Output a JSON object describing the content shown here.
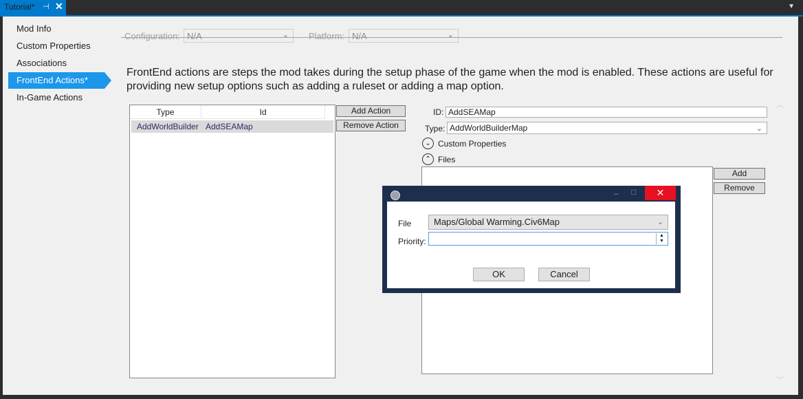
{
  "tab": {
    "title": "Tutorial*",
    "pin_glyph": "⊣",
    "close_glyph": "✕",
    "overflow_glyph": "▼"
  },
  "nav": {
    "items": [
      {
        "label": "Mod Info"
      },
      {
        "label": "Custom Properties"
      },
      {
        "label": "Associations"
      },
      {
        "label": "FrontEnd Actions*"
      },
      {
        "label": "In-Game Actions"
      }
    ],
    "selected_index": 3
  },
  "config": {
    "configuration_label": "Configuration:",
    "configuration_value": "N/A",
    "platform_label": "Platform:",
    "platform_value": "N/A"
  },
  "description": "FrontEnd actions are steps the mod takes during the setup phase of the game when the mod is enabled.  These actions are useful for providing new setup options such as adding a ruleset or adding a map option.",
  "actions_table": {
    "columns": [
      "Type",
      "Id"
    ],
    "rows": [
      [
        "AddWorldBuilderM",
        "AddSEAMap"
      ]
    ]
  },
  "buttons": {
    "add_action": "Add Action",
    "remove_action": "Remove Action",
    "add": "Add",
    "remove": "Remove"
  },
  "details": {
    "id_label": "ID:",
    "id_value": "AddSEAMap",
    "type_label": "Type:",
    "type_value": "AddWorldBuilderMap",
    "custom_properties_label": "Custom Properties",
    "files_label": "Files"
  },
  "dialog": {
    "file_label": "File",
    "file_value": "Maps/Global Warming.Civ6Map",
    "priority_label": "Priority:",
    "priority_value": "",
    "ok_label": "OK",
    "cancel_label": "Cancel",
    "close_glyph": "✕"
  },
  "colors": {
    "accent": "#007acc",
    "selection": "#1c97ea",
    "dialog_frame": "#1d2f4d",
    "close_red": "#e81123"
  }
}
